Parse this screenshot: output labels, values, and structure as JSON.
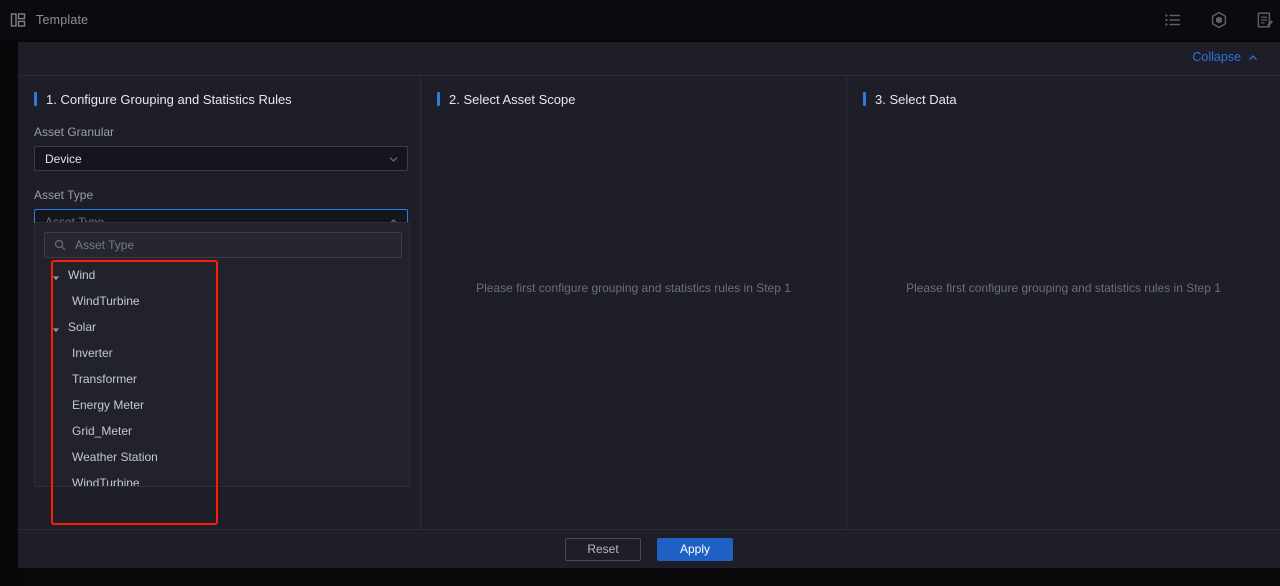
{
  "topbar": {
    "title": "Template",
    "logo_icon": "layout-grid-icon",
    "actions": [
      {
        "icon": "list-icon",
        "name": "list-view-icon"
      },
      {
        "icon": "hexagon-icon",
        "name": "settings-hexagon-icon"
      },
      {
        "icon": "edit-document-icon",
        "name": "edit-document-icon"
      }
    ]
  },
  "collapse": {
    "label": "Collapse",
    "icon": "chevron-up-icon"
  },
  "steps": {
    "step1": {
      "title": "1. Configure Grouping and Statistics Rules",
      "fields": {
        "asset_granular": {
          "label": "Asset Granular",
          "value": "Device",
          "icon": "chevron-down-icon"
        },
        "asset_type": {
          "label": "Asset Type",
          "placeholder": "Asset Type",
          "value": "",
          "icon": "chevron-up-icon"
        }
      },
      "dropdown": {
        "search_placeholder": "Asset Type",
        "search_icon": "search-icon",
        "groups": [
          {
            "label": "Wind",
            "expanded": true,
            "items": [
              "WindTurbine"
            ]
          },
          {
            "label": "Solar",
            "expanded": true,
            "items": [
              "Inverter",
              "Transformer",
              "Energy Meter",
              "Grid_Meter",
              "Weather Station",
              "WindTurbine"
            ]
          }
        ]
      }
    },
    "step2": {
      "title": "2. Select Asset Scope",
      "empty_hint": "Please first configure grouping and statistics rules in Step 1"
    },
    "step3": {
      "title": "3. Select Data",
      "empty_hint": "Please first configure grouping and statistics rules in Step 1"
    }
  },
  "footer": {
    "reset_label": "Reset",
    "apply_label": "Apply"
  },
  "colors": {
    "accent_blue": "#2f7be0",
    "apply_blue": "#1f60c4",
    "annotation_red": "#fe1c0a",
    "panel_bg": "#1e1e28",
    "page_bg": "#08080b"
  }
}
